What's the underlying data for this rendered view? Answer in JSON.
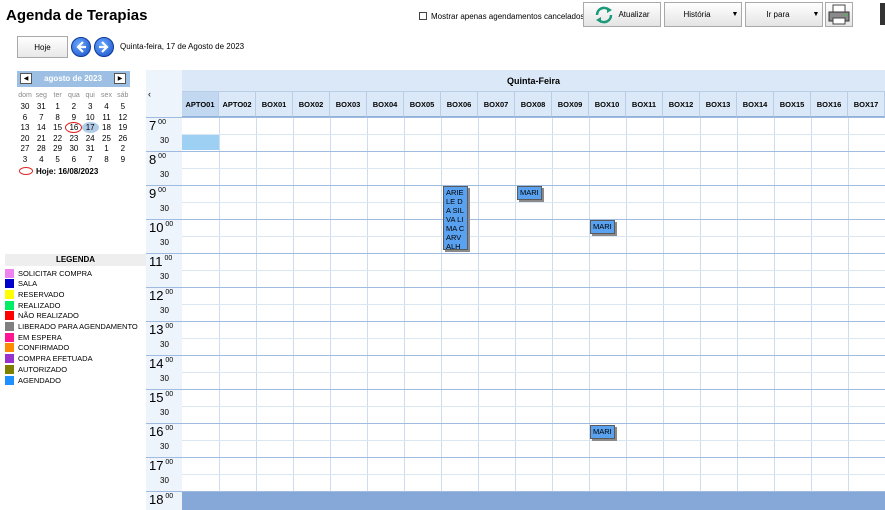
{
  "header": {
    "title": "Agenda de Terapias",
    "cancel_filter_label": "Mostrar apenas agendamentos cancelados",
    "refresh_label": "Atualizar",
    "history_label": "História",
    "goto_label": "Ir para"
  },
  "date_nav": {
    "today_label": "Hoje",
    "current_date": "Quinta-feira, 17 de Agosto de 2023"
  },
  "mini_calendar": {
    "month_label": "agosto de 2023",
    "weekdays": [
      "dom",
      "seg",
      "ter",
      "qua",
      "qui",
      "sex",
      "sáb"
    ],
    "weeks": [
      [
        "30",
        "31",
        "1",
        "2",
        "3",
        "4",
        "5"
      ],
      [
        "6",
        "7",
        "8",
        "9",
        "10",
        "11",
        "12"
      ],
      [
        "13",
        "14",
        "15",
        "16",
        "17",
        "18",
        "19"
      ],
      [
        "20",
        "21",
        "22",
        "23",
        "24",
        "25",
        "26"
      ],
      [
        "27",
        "28",
        "29",
        "30",
        "31",
        "1",
        "2"
      ],
      [
        "3",
        "4",
        "5",
        "6",
        "7",
        "8",
        "9"
      ]
    ],
    "today_text": "Hoje: 16/08/2023"
  },
  "legend": {
    "title": "LEGENDA",
    "items": [
      {
        "label": "SOLICITAR COMPRA",
        "color": "#ee82ee"
      },
      {
        "label": "SALA",
        "color": "#0000cc"
      },
      {
        "label": "RESERVADO",
        "color": "#ffff00"
      },
      {
        "label": "REALIZADO",
        "color": "#00ee66"
      },
      {
        "label": "NÃO REALIZADO",
        "color": "#ff0000"
      },
      {
        "label": "LIBERADO PARA AGENDAMENTO",
        "color": "#808080"
      },
      {
        "label": "EM ESPERA",
        "color": "#ff1493"
      },
      {
        "label": "CONFIRMADO",
        "color": "#ff8c00"
      },
      {
        "label": "COMPRA EFETUADA",
        "color": "#9932cc"
      },
      {
        "label": "AUTORIZADO",
        "color": "#808000"
      },
      {
        "label": "AGENDADO",
        "color": "#1e90ff"
      }
    ]
  },
  "schedule": {
    "day_label": "Quinta-Feira",
    "columns": [
      "APTO01",
      "APTO02",
      "BOX01",
      "BOX02",
      "BOX03",
      "BOX04",
      "BOX05",
      "BOX06",
      "BOX07",
      "BOX08",
      "BOX09",
      "BOX10",
      "BOX11",
      "BOX12",
      "BOX13",
      "BOX14",
      "BOX15",
      "BOX16",
      "BOX17"
    ],
    "hours": [
      "7",
      "8",
      "9",
      "10",
      "11",
      "12",
      "13",
      "14",
      "15",
      "16",
      "17",
      "18"
    ],
    "minute_zero": "00",
    "minute_half": "30",
    "appointments": [
      {
        "column": "BOX06",
        "start": "09:00",
        "end": "11:00",
        "text": "ARIELE DA SILVA LIMA CARVALHO"
      },
      {
        "column": "BOX08",
        "start": "09:00",
        "end": "09:30",
        "text": "MARI"
      },
      {
        "column": "BOX10",
        "start": "10:00",
        "end": "10:30",
        "text": "MARI"
      },
      {
        "column": "BOX10",
        "start": "16:00",
        "end": "16:30",
        "text": "MARI"
      }
    ]
  }
}
